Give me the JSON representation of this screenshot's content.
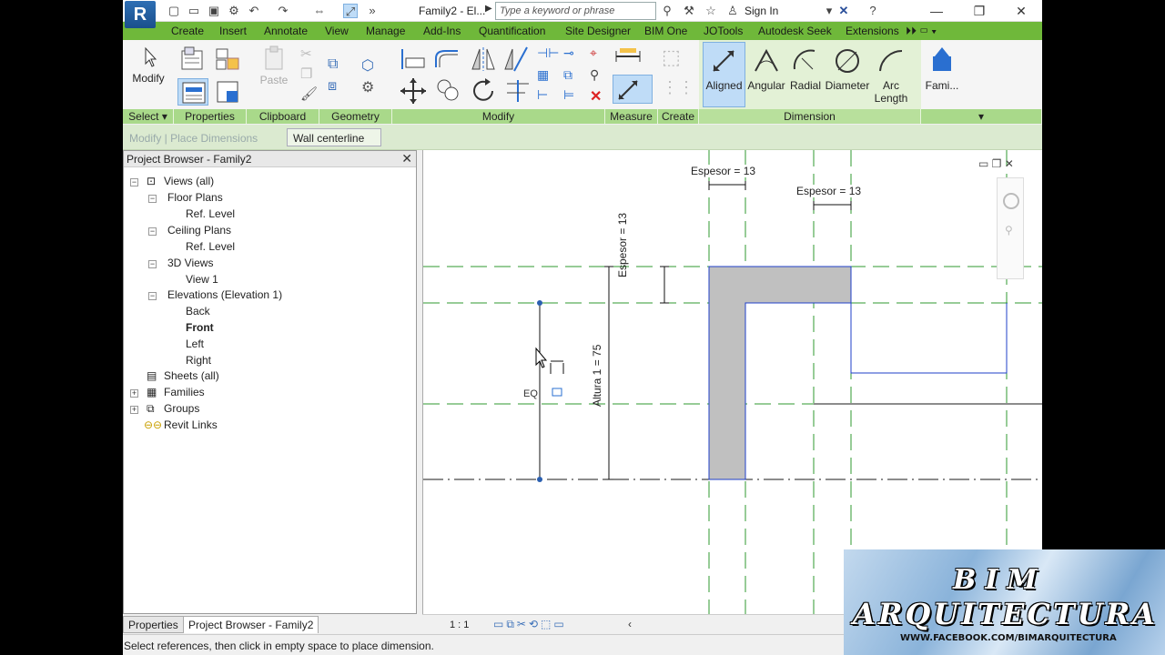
{
  "app": {
    "logo": "R",
    "doc_title": "Family2 - El...",
    "search_placeholder": "Type a keyword or phrase",
    "signin": "Sign In"
  },
  "tabs": [
    "Create",
    "Insert",
    "Annotate",
    "View",
    "Manage",
    "Add-Ins",
    "Quantification",
    "Site Designer",
    "BIM One",
    "JOTools",
    "Autodesk Seek",
    "Extensions"
  ],
  "ribbon": {
    "modify_label": "Modify",
    "paste_label": "Paste",
    "panels": [
      "Select",
      "Properties",
      "Clipboard",
      "Geometry",
      "Modify",
      "Measure",
      "Create",
      "Dimension"
    ],
    "dimension_tools": [
      "Aligned",
      "Angular",
      "Radial",
      "Diameter",
      "Arc",
      "Length"
    ],
    "family_label": "Fami..."
  },
  "options": {
    "mode": "Modify | Place Dimensions",
    "placement": "Wall centerline"
  },
  "browser": {
    "title": "Project Browser - Family2",
    "items": [
      "Views (all)",
      "Floor Plans",
      "Ref. Level",
      "Ceiling Plans",
      "Ref. Level",
      "3D Views",
      "View 1",
      "Elevations (Elevation 1)",
      "Back",
      "Front",
      "Left",
      "Right",
      "Sheets (all)",
      "Families",
      "Groups",
      "Revit Links"
    ]
  },
  "bottom_tabs": [
    "Properties",
    "Project Browser - Family2"
  ],
  "canvas": {
    "dim_top": "Espesor = 13",
    "dim_top2": "Espesor = 13",
    "dim_vert": "Espesor = 13",
    "dim_height": "Altura 1 = 75"
  },
  "viewbar": {
    "scale": "1 : 1"
  },
  "status": "Select references, then click in empty space to place dimension.",
  "watermark": {
    "line1": "BIM",
    "line2": "ARQUITECTURA",
    "line3": "WWW.FACEBOOK.COM/BIMARQUITECTURA"
  },
  "colors": {
    "tab_bar": "#6fb83a",
    "panel_label": "#a9d98a",
    "ref_plane": "#2f9a2f",
    "wall_fill": "#c0c0c0",
    "sketch_blue": "#1f3fc8"
  }
}
